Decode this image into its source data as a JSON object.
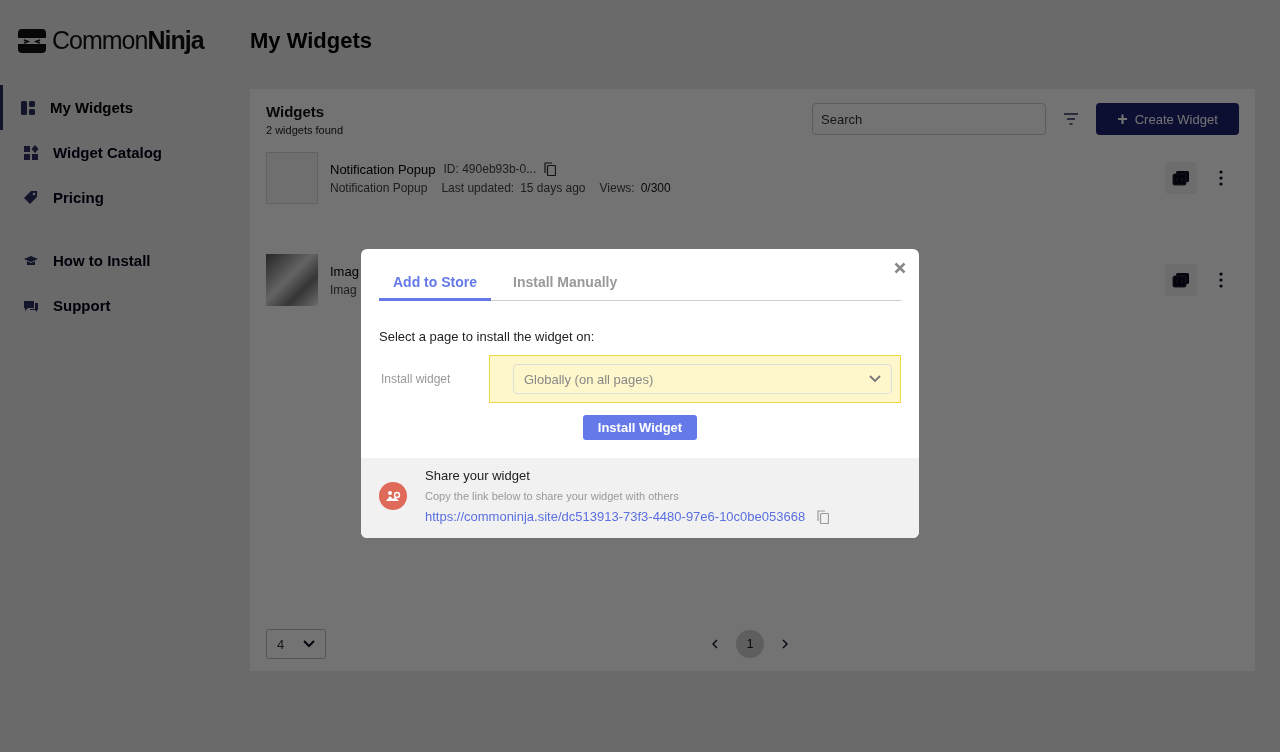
{
  "sidebar": {
    "logo": {
      "light": "Common",
      "bold": "Ninja"
    },
    "sections": [
      {
        "items": [
          {
            "label": "My Widgets",
            "selected": true
          },
          {
            "label": "Widget Catalog",
            "selected": false
          },
          {
            "label": "Pricing",
            "selected": false
          }
        ]
      },
      {
        "items": [
          {
            "label": "How to Install",
            "selected": false
          },
          {
            "label": "Support",
            "selected": false
          }
        ]
      }
    ]
  },
  "main": {
    "title": "My Widgets",
    "panel": {
      "title": "Widgets",
      "count": "2 widgets found",
      "search": {
        "placeholder": "Search"
      },
      "create_button": {
        "icon": "+",
        "label": "Create Widget"
      },
      "rows": [
        {
          "name": "Notification Popup",
          "id": "ID: 490eb93b-0...",
          "type": "Notification Popup",
          "updated_label": "Last updated:",
          "updated": "15 days ago",
          "views_label": "Views:",
          "views": "0/300",
          "thumbnail": false
        },
        {
          "name": "Imag",
          "type": "Imag",
          "thumbnail": true
        }
      ],
      "page_size": "4",
      "pages": [
        {
          "label": "1",
          "selected": true
        }
      ]
    }
  },
  "modal": {
    "tabs": [
      {
        "label": "Add to Store",
        "selected": true
      },
      {
        "label": "Install Manually",
        "selected": false
      }
    ],
    "prompt": "Select a page to install the widget on:",
    "field_label": "Install widget",
    "select": {
      "value": "Globally (on all pages)",
      "highlighted": true
    },
    "button": "Install Widget",
    "share": {
      "title": "Share your widget",
      "description": "Copy the link below to share your widget with others",
      "link": "https://commoninja.site/dc513913-73f3-4480-97e6-10c0be053668"
    }
  }
}
